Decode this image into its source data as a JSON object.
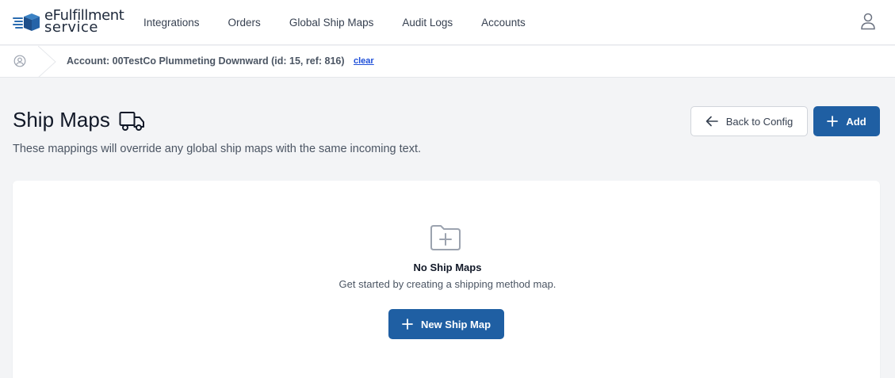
{
  "brand": {
    "line1": "eFulfillment",
    "line2": "service"
  },
  "nav": {
    "items": [
      {
        "label": "Integrations"
      },
      {
        "label": "Orders"
      },
      {
        "label": "Global Ship Maps"
      },
      {
        "label": "Audit Logs"
      },
      {
        "label": "Accounts"
      }
    ]
  },
  "breadcrumb": {
    "account": "Account: 00TestCo Plummeting Downward (id: 15, ref: 816)",
    "clear": "clear"
  },
  "header": {
    "title": "Ship Maps",
    "subtitle": "These mappings will override any global ship maps with the same incoming text."
  },
  "actions": {
    "back_label": "Back to Config",
    "add_label": "Add"
  },
  "empty_state": {
    "title": "No Ship Maps",
    "message": "Get started by creating a shipping method map.",
    "button_label": "New Ship Map"
  },
  "colors": {
    "primary": "#1f5fa3",
    "link": "#1d4ed8",
    "page_bg": "#f3f4f6"
  }
}
